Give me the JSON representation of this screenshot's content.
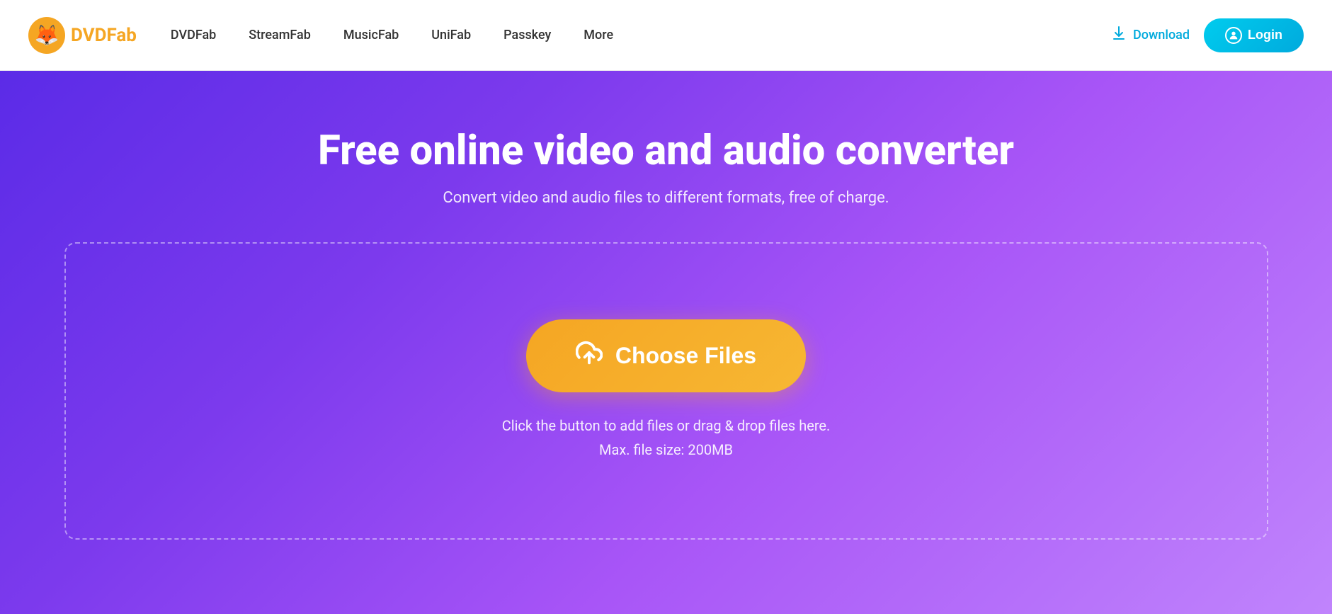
{
  "navbar": {
    "logo_text": "DVDFab",
    "logo_emoji": "🦊",
    "nav_items": [
      {
        "label": "DVDFab"
      },
      {
        "label": "StreamFab"
      },
      {
        "label": "MusicFab"
      },
      {
        "label": "UniFab"
      },
      {
        "label": "Passkey"
      },
      {
        "label": "More"
      }
    ],
    "download_label": "Download",
    "login_label": "Login"
  },
  "hero": {
    "title": "Free online video and audio converter",
    "subtitle": "Convert video and audio files to different formats, free of charge.",
    "choose_files_label": "Choose Files",
    "upload_hint_line1": "Click the button to add files or drag & drop files here.",
    "upload_hint_line2": "Max. file size: 200MB"
  }
}
